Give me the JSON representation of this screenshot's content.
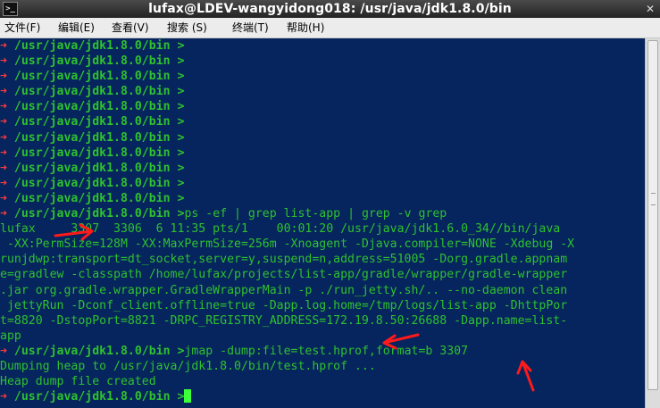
{
  "window": {
    "title": "lufax@LDEV-wangyidong018: /usr/java/jdk1.8.0/bin",
    "icon_glyph": ">_",
    "close_glyph": "✕"
  },
  "menu": {
    "items": [
      "文件(F)",
      "编辑(E)",
      "查看(V)",
      "搜索 (S)",
      "终端(T)",
      "帮助(H)"
    ]
  },
  "terminal": {
    "prompt_arrow": "➜ ",
    "cwd": "/usr/java/jdk1.8.0/bin",
    "prompt_tail": " >",
    "empty_prompt_count": 11,
    "cmd1": "ps -ef | grep list-app | grep -v grep",
    "ps_output": [
      "lufax     3307  3306  6 11:35 pts/1    00:01:20 /usr/java/jdk1.6.0_34//bin/java",
      " -XX:PermSize=128M -XX:MaxPermSize=256m -Xnoagent -Djava.compiler=NONE -Xdebug -X",
      "runjdwp:transport=dt_socket,server=y,suspend=n,address=51005 -Dorg.gradle.appnam",
      "e=gradlew -classpath /home/lufax/projects/list-app/gradle/wrapper/gradle-wrapper",
      ".jar org.gradle.wrapper.GradleWrapperMain -p ./run_jetty.sh/.. --no-daemon clean",
      " jettyRun -Dconf_client.offline=true -Dapp.log.home=/tmp/logs/list-app -DhttpPor",
      "t=8820 -DstopPort=8821 -DRPC_REGISTRY_ADDRESS=172.19.8.50:26688 -Dapp.name=list-",
      "app"
    ],
    "cmd2": "jmap -dump:file=test.hprof,format=b 3307",
    "jmap_output": [
      "Dumping heap to /usr/java/jdk1.8.0/bin/test.hprof ...",
      "Heap dump file created"
    ]
  },
  "colors": {
    "terminal_bg": "#06245e",
    "text_green": "#2ec22e",
    "arrow_red": "#ff3a3a",
    "annotation_red": "#ff1a1a"
  }
}
